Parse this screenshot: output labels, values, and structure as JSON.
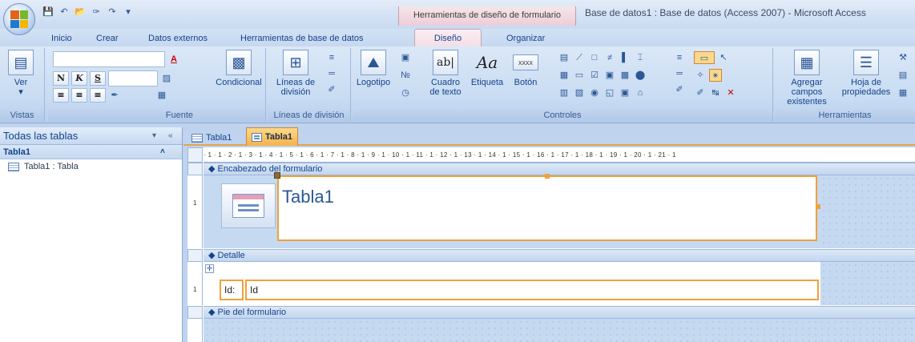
{
  "window": {
    "app_title": "Base de datos1 : Base de datos (Access 2007) - Microsoft Access",
    "contextual_tab_title": "Herramientas de diseño de formulario"
  },
  "quick_access": [
    "save-icon",
    "undo-icon",
    "open-icon",
    "format-painter-icon",
    "redo-icon",
    "customize-icon"
  ],
  "ribbon_tabs": [
    {
      "label": "Inicio"
    },
    {
      "label": "Crear"
    },
    {
      "label": "Datos externos"
    },
    {
      "label": "Herramientas de base de datos"
    },
    {
      "label": "Diseño",
      "active": true
    },
    {
      "label": "Organizar"
    }
  ],
  "groups": {
    "vistas": {
      "label": "Vistas",
      "ver": "Ver"
    },
    "fuente": {
      "label": "Fuente",
      "condicional": "Condicional",
      "bold": "N",
      "italic": "K",
      "underline": "S"
    },
    "lineas": {
      "label": "Líneas de división",
      "button": "Líneas de división"
    },
    "controles": {
      "label": "Controles",
      "logotipo": "Logotipo",
      "cuadro": "Cuadro de texto",
      "etiqueta": "Etiqueta",
      "boton": "Botón",
      "textbox_glyph": "ab|",
      "label_glyph": "Aa",
      "button_glyph": "xxxx"
    },
    "herramientas": {
      "label": "Herramientas",
      "agregar": "Agregar campos existentes",
      "hoja": "Hoja de propiedades"
    }
  },
  "nav": {
    "header": "Todas las tablas",
    "group": "Tabla1",
    "items": [
      {
        "label": "Tabla1 : Tabla"
      }
    ]
  },
  "doc_tabs": [
    {
      "label": "Tabla1",
      "active": false
    },
    {
      "label": "Tabla1",
      "active": true
    }
  ],
  "ruler": "· 1 · 1 · 2 · 1 · 3 · 1 · 4 · 1 · 5 · 1 · 6 · 1 · 7 · 1 · 8 · 1 · 9 · 1 · 10 · 1 · 11 · 1 · 12 · 1 · 13 · 1 · 14 · 1 · 15 · 1 · 16 · 1 · 17 · 1 · 18 · 1 · 19 · 1 · 20 · 1 · 21 · 1",
  "vruler_marks": {
    "header": "1",
    "detail": "1"
  },
  "sections": {
    "header": "Encabezado del formulario",
    "detail": "Detalle",
    "footer": "Pie del formulario"
  },
  "form": {
    "title_label": "Tabla1",
    "field_label": "Id:",
    "field_textbox": "Id"
  }
}
